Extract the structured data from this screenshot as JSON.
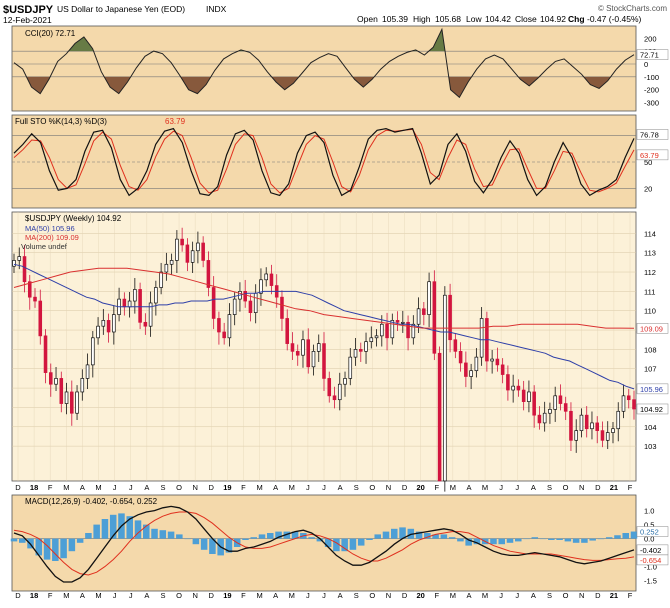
{
  "header": {
    "symbol": "$USDJPY",
    "description": "US Dollar to Japanese Yen (EOD)",
    "exchange": "INDX",
    "date": "12-Feb-2021",
    "open_label": "Open",
    "open": "105.39",
    "high_label": "High",
    "high": "105.68",
    "low_label": "Low",
    "low": "104.42",
    "close_label": "Close",
    "close": "104.92",
    "chg_label": "Chg",
    "chg": "-0.47 (-0.45%)",
    "watermark": "© StockCharts.com"
  },
  "colors": {
    "panel_bg": "#f4d9ab",
    "price_bg": "#fcf1d8",
    "up_candle": "#ffffff",
    "down_candle": "#d2153f",
    "ma50": "#2e3fa8",
    "ma200": "#d93030",
    "cci_pos_fill": "#58703a",
    "cci_neg_fill": "#7b4a30",
    "macd_hist": "#4d9fd6",
    "signal": "#e0301e"
  },
  "chart_data": [
    {
      "id": "cci",
      "type": "line",
      "title": "CCI(20) 72.71",
      "last_value": "72.71",
      "ylim": [
        -350,
        280
      ],
      "yticks": [
        "200",
        "100",
        "0",
        "-100",
        "-200",
        "-300"
      ],
      "ref_lines": [
        100,
        0,
        -100
      ],
      "values": [
        10,
        -40,
        -180,
        -230,
        -120,
        20,
        80,
        160,
        210,
        120,
        -60,
        -180,
        -230,
        -140,
        -30,
        60,
        100,
        80,
        10,
        -90,
        -200,
        -230,
        -160,
        -50,
        40,
        80,
        110,
        90,
        30,
        -60,
        -140,
        -200,
        -150,
        -70,
        10,
        50,
        80,
        60,
        -30,
        -120,
        -180,
        -120,
        -40,
        20,
        60,
        90,
        110,
        70,
        130,
        270,
        -200,
        -260,
        -140,
        -40,
        40,
        70,
        40,
        -40,
        -120,
        -170,
        -110,
        -40,
        20,
        40,
        -20,
        -80,
        -160,
        -190,
        -130,
        -40,
        30,
        72.71
      ]
    },
    {
      "id": "stoch",
      "type": "line",
      "title": "Full STO %K(14,3) %D(3)",
      "k_label": "76.78",
      "d_label": "63.79",
      "ylim": [
        0,
        100
      ],
      "yticks": [
        "80",
        "50",
        "20"
      ],
      "ref_lines": [
        80,
        50,
        20
      ],
      "series": [
        {
          "name": "%K",
          "values": [
            60,
            70,
            82,
            72,
            40,
            18,
            20,
            30,
            62,
            84,
            86,
            66,
            30,
            12,
            20,
            40,
            70,
            85,
            88,
            72,
            40,
            14,
            12,
            22,
            58,
            82,
            86,
            75,
            40,
            15,
            12,
            25,
            60,
            80,
            84,
            72,
            35,
            12,
            18,
            45,
            76,
            86,
            88,
            84,
            86,
            88,
            60,
            25,
            35,
            70,
            82,
            62,
            28,
            15,
            30,
            55,
            74,
            60,
            30,
            12,
            22,
            50,
            72,
            55,
            25,
            12,
            18,
            22,
            30,
            55,
            76.78
          ]
        },
        {
          "name": "%D",
          "values": [
            55,
            64,
            75,
            74,
            55,
            30,
            20,
            24,
            48,
            74,
            84,
            76,
            46,
            22,
            18,
            30,
            56,
            76,
            85,
            80,
            55,
            26,
            15,
            18,
            42,
            70,
            82,
            80,
            55,
            25,
            15,
            20,
            45,
            70,
            80,
            76,
            50,
            22,
            16,
            35,
            64,
            80,
            86,
            85,
            86,
            87,
            70,
            38,
            30,
            55,
            75,
            70,
            42,
            22,
            24,
            45,
            64,
            65,
            42,
            20,
            20,
            40,
            62,
            60,
            38,
            18,
            16,
            20,
            26,
            45,
            63.79
          ]
        }
      ]
    },
    {
      "id": "price",
      "type": "candlestick",
      "title": "$USDJPY (Weekly) 104.92",
      "legend": [
        "MA(50) 105.96",
        "MA(200) 109.09",
        "Volume undef"
      ],
      "ma50_label": "105.96",
      "ma200_label": "109.09",
      "close_label": "104.92",
      "ylim": [
        101.3,
        115.0
      ],
      "yticks": [
        103,
        104,
        105,
        106,
        107,
        108,
        109,
        110,
        111,
        112,
        113,
        114
      ],
      "x_labels": [
        "D",
        "18",
        "F",
        "M",
        "A",
        "M",
        "J",
        "J",
        "A",
        "S",
        "O",
        "N",
        "D",
        "19",
        "F",
        "M",
        "A",
        "M",
        "J",
        "J",
        "A",
        "S",
        "O",
        "N",
        "D",
        "20",
        "F",
        "M",
        "A",
        "M",
        "J",
        "J",
        "A",
        "S",
        "O",
        "N",
        "D",
        "21",
        "F"
      ],
      "close": [
        112.6,
        112.8,
        111.5,
        110.7,
        110.5,
        108.7,
        106.8,
        106.2,
        106.5,
        105.2,
        105.8,
        104.7,
        105.8,
        106.5,
        107.2,
        108.6,
        109.2,
        109.5,
        108.9,
        109.8,
        110.6,
        110.2,
        110.5,
        111.1,
        109.4,
        109.2,
        110.4,
        111.2,
        112.0,
        112.4,
        112.6,
        113.7,
        113.4,
        112.5,
        113.1,
        113.5,
        112.6,
        111.2,
        109.6,
        108.9,
        108.6,
        109.8,
        110.6,
        111.0,
        110.5,
        109.9,
        110.9,
        111.6,
        111.9,
        111.3,
        110.7,
        109.6,
        108.3,
        107.9,
        107.7,
        108.5,
        107.1,
        107.9,
        108.3,
        106.5,
        105.6,
        105.4,
        106.2,
        106.5,
        107.6,
        108.0,
        107.9,
        108.4,
        108.6,
        108.7,
        109.3,
        108.6,
        109.5,
        109.4,
        109.4,
        108.6,
        109.3,
        110.1,
        109.8,
        111.5,
        107.8,
        101.2,
        110.8,
        108.5,
        107.9,
        107.3,
        106.6,
        106.9,
        107.6,
        109.6,
        107.4,
        107.5,
        107.2,
        106.7,
        105.9,
        106.1,
        105.9,
        105.3,
        105.8,
        104.6,
        104.2,
        104.7,
        104.9,
        105.6,
        105.2,
        104.8,
        103.3,
        103.8,
        104.6,
        103.9,
        104.2,
        103.8,
        103.3,
        103.7,
        103.9,
        104.8,
        105.6,
        105.4,
        104.92
      ],
      "ma50": [
        112.4,
        112.3,
        112.1,
        111.9,
        111.7,
        111.5,
        111.3,
        111.1,
        110.9,
        110.7,
        110.6,
        110.4,
        110.3,
        110.2,
        110.2,
        110.2,
        110.2,
        110.2,
        110.3,
        110.3,
        110.4,
        110.4,
        110.5,
        110.5,
        110.5,
        110.6,
        110.6,
        110.7,
        110.8,
        110.9,
        110.9,
        111.0,
        111.0,
        111.0,
        111.0,
        111.0,
        110.9,
        110.8,
        110.6,
        110.4,
        110.2,
        110.0,
        109.9,
        109.8,
        109.7,
        109.6,
        109.5,
        109.4,
        109.3,
        109.3,
        109.2,
        109.1,
        109.0,
        108.9,
        108.9,
        108.8,
        108.7,
        108.6,
        108.5,
        108.5,
        108.4,
        108.3,
        108.2,
        108.1,
        108.0,
        107.9,
        107.8,
        107.6,
        107.5,
        107.4,
        107.2,
        107.0,
        106.8,
        106.6,
        106.4,
        106.3,
        106.1,
        105.96
      ]
    },
    {
      "id": "macd",
      "type": "line",
      "title": "MACD(12,26,9) -0.402, -0.654, 0.252",
      "macd_label": "-0.402",
      "signal_label": "-0.654",
      "hist_label": "0.252",
      "ylim": [
        -1.8,
        1.45
      ],
      "yticks": [
        "1.0",
        "0.5",
        "0.0",
        "-0.5",
        "-1.0",
        "-1.5"
      ],
      "series": [
        {
          "name": "MACD",
          "values": [
            0.2,
            0.1,
            -0.2,
            -0.6,
            -1.0,
            -1.35,
            -1.55,
            -1.55,
            -1.4,
            -1.1,
            -0.7,
            -0.3,
            0.1,
            0.45,
            0.7,
            0.85,
            0.95,
            1.0,
            1.1,
            1.15,
            1.1,
            0.95,
            0.7,
            0.35,
            0.0,
            -0.3,
            -0.45,
            -0.45,
            -0.35,
            -0.3,
            -0.2,
            -0.1,
            0.05,
            0.15,
            0.25,
            0.3,
            0.2,
            0.0,
            -0.3,
            -0.6,
            -0.8,
            -0.95,
            -0.95,
            -0.85,
            -0.65,
            -0.45,
            -0.2,
            0.0,
            0.15,
            0.2,
            0.25,
            0.3,
            0.35,
            0.3,
            0.15,
            -0.05,
            -0.15,
            -0.3,
            -0.45,
            -0.55,
            -0.6,
            -0.6,
            -0.55,
            -0.5,
            -0.55,
            -0.6,
            -0.65,
            -0.75,
            -0.85,
            -0.9,
            -0.85,
            -0.8,
            -0.7,
            -0.6,
            -0.5,
            -0.402
          ]
        },
        {
          "name": "Signal",
          "values": [
            0.3,
            0.25,
            0.15,
            0.0,
            -0.25,
            -0.55,
            -0.85,
            -1.1,
            -1.25,
            -1.3,
            -1.2,
            -1.0,
            -0.75,
            -0.45,
            -0.1,
            0.2,
            0.45,
            0.65,
            0.8,
            0.9,
            0.95,
            0.95,
            0.9,
            0.75,
            0.55,
            0.3,
            0.05,
            -0.15,
            -0.3,
            -0.35,
            -0.35,
            -0.3,
            -0.2,
            -0.1,
            0.0,
            0.1,
            0.15,
            0.1,
            0.0,
            -0.15,
            -0.35,
            -0.55,
            -0.7,
            -0.8,
            -0.8,
            -0.7,
            -0.55,
            -0.4,
            -0.2,
            -0.05,
            0.05,
            0.15,
            0.2,
            0.25,
            0.25,
            0.2,
            0.05,
            -0.1,
            -0.25,
            -0.35,
            -0.45,
            -0.5,
            -0.55,
            -0.55,
            -0.55,
            -0.55,
            -0.6,
            -0.65,
            -0.7,
            -0.75,
            -0.78,
            -0.78,
            -0.75,
            -0.72,
            -0.7,
            -0.654
          ]
        }
      ]
    }
  ]
}
